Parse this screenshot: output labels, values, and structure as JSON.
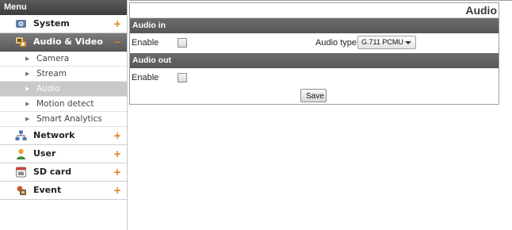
{
  "sidebar": {
    "title": "Menu",
    "categories": [
      {
        "label": "System",
        "toggle": "+",
        "icon": "system-gear-icon",
        "active": false
      },
      {
        "label": "Audio & Video",
        "toggle": "−",
        "icon": "audio-video-icon",
        "active": true
      },
      {
        "label": "Network",
        "toggle": "+",
        "icon": "network-icon",
        "active": false
      },
      {
        "label": "User",
        "toggle": "+",
        "icon": "user-icon",
        "active": false
      },
      {
        "label": "SD card",
        "toggle": "+",
        "icon": "sd-card-icon",
        "active": false
      },
      {
        "label": "Event",
        "toggle": "+",
        "icon": "event-icon",
        "active": false
      }
    ],
    "subitems": [
      {
        "label": "Camera",
        "active": false
      },
      {
        "label": "Stream",
        "active": false
      },
      {
        "label": "Audio",
        "active": true
      },
      {
        "label": "Motion detect",
        "active": false
      },
      {
        "label": "Smart Analytics",
        "active": false
      }
    ]
  },
  "panel": {
    "title": "Audio",
    "audio_in": {
      "header": "Audio in",
      "enable_label": "Enable",
      "enabled": false,
      "audio_type_label": "Audio type",
      "audio_type_value": "G.711 PCMU"
    },
    "audio_out": {
      "header": "Audio out",
      "enable_label": "Enable",
      "enabled": false
    },
    "save_label": "Save"
  },
  "colors": {
    "accent_toggle": "#e07b1a",
    "section_bg": "#616161",
    "active_sub_bg": "#c9c9c9"
  }
}
